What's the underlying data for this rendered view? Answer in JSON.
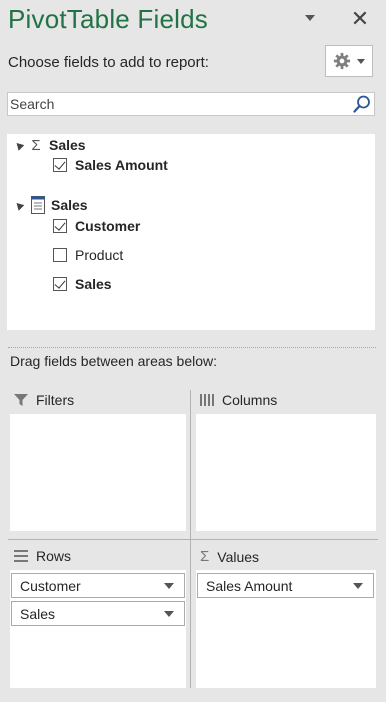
{
  "header": {
    "title": "PivotTable Fields",
    "choose_label": "Choose fields to add to report:",
    "dropdown_icon": "chevron-down-icon",
    "close_glyph": "✕",
    "gear_icon": "gear-icon"
  },
  "search": {
    "placeholder": "Search",
    "value": ""
  },
  "fields": {
    "table1": {
      "name": "Sales",
      "fields": [
        {
          "label": "Sales Amount",
          "checked": true
        }
      ]
    },
    "table2": {
      "name": "Sales",
      "fields": [
        {
          "label": "Customer",
          "checked": true
        },
        {
          "label": "Product",
          "checked": false
        },
        {
          "label": "Sales",
          "checked": true
        }
      ]
    }
  },
  "areas": {
    "drag_label": "Drag fields between areas below:",
    "filters": {
      "title": "Filters",
      "items": []
    },
    "columns": {
      "title": "Columns",
      "items": []
    },
    "rows": {
      "title": "Rows",
      "items": [
        "Customer",
        "Sales"
      ]
    },
    "values": {
      "title": "Values",
      "items": [
        "Sales Amount"
      ]
    }
  },
  "colors": {
    "accent": "#217346",
    "panel_bg": "#e6e6e6"
  }
}
